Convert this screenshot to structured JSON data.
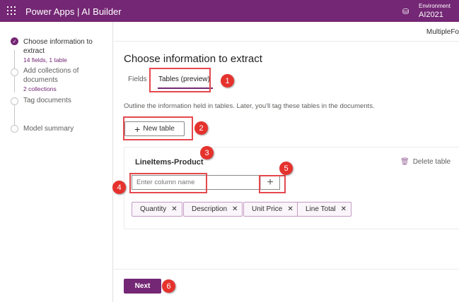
{
  "header": {
    "title": "Power Apps | AI Builder",
    "environment_label": "Environment",
    "environment_value": "AI2021"
  },
  "sidebar": {
    "steps": [
      {
        "label": "Choose information to extract",
        "sub": "14 fields, 1 table",
        "state": "done"
      },
      {
        "label": "Add collections of documents",
        "sub": "2 collections",
        "state": "todo"
      },
      {
        "label": "Tag documents",
        "state": "todo"
      },
      {
        "label": "Model summary",
        "state": "todo"
      }
    ]
  },
  "topbar": {
    "model_name": "MultipleFo"
  },
  "main": {
    "title": "Choose information to extract",
    "tabs": [
      {
        "label": "Fields"
      },
      {
        "label": "Tables (preview)",
        "active": true
      }
    ],
    "description": "Outline the information held in tables. Later, you'll tag these tables in the documents.",
    "new_table_label": "New table",
    "table": {
      "name": "LineItems-Product",
      "delete_label": "Delete table",
      "column_placeholder": "Enter column name",
      "columns": [
        "Quantity",
        "Description",
        "Unit Price",
        "Line Total"
      ]
    },
    "next_label": "Next"
  },
  "annotations": [
    "1",
    "2",
    "3",
    "4",
    "5",
    "6"
  ],
  "colors": {
    "brand": "#742774",
    "annotation": "#e5322d"
  }
}
